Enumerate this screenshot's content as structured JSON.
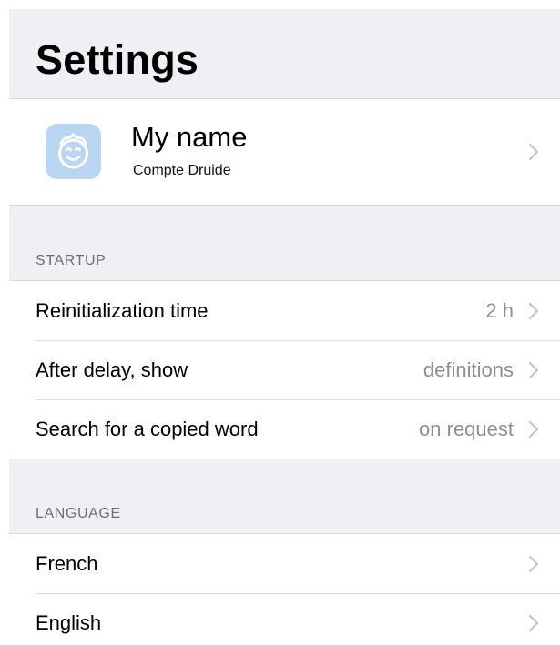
{
  "header": {
    "title": "Settings"
  },
  "profile": {
    "name": "My name",
    "subtitle": "Compte Druide",
    "avatar_icon": "smiling-face-icon",
    "avatar_color": "#b9d5f2"
  },
  "sections": {
    "startup": {
      "header": "STARTUP",
      "rows": [
        {
          "label": "Reinitialization time",
          "value": "2 h"
        },
        {
          "label": "After delay, show",
          "value": "definitions"
        },
        {
          "label": "Search for a copied word",
          "value": "on request"
        }
      ]
    },
    "language": {
      "header": "LANGUAGE",
      "rows": [
        {
          "label": "French"
        },
        {
          "label": "English"
        }
      ]
    }
  },
  "colors": {
    "background": "#efeff4",
    "secondary_text": "#8e8e93",
    "section_header_text": "#6d6d72",
    "chevron": "#c4c4c8"
  }
}
